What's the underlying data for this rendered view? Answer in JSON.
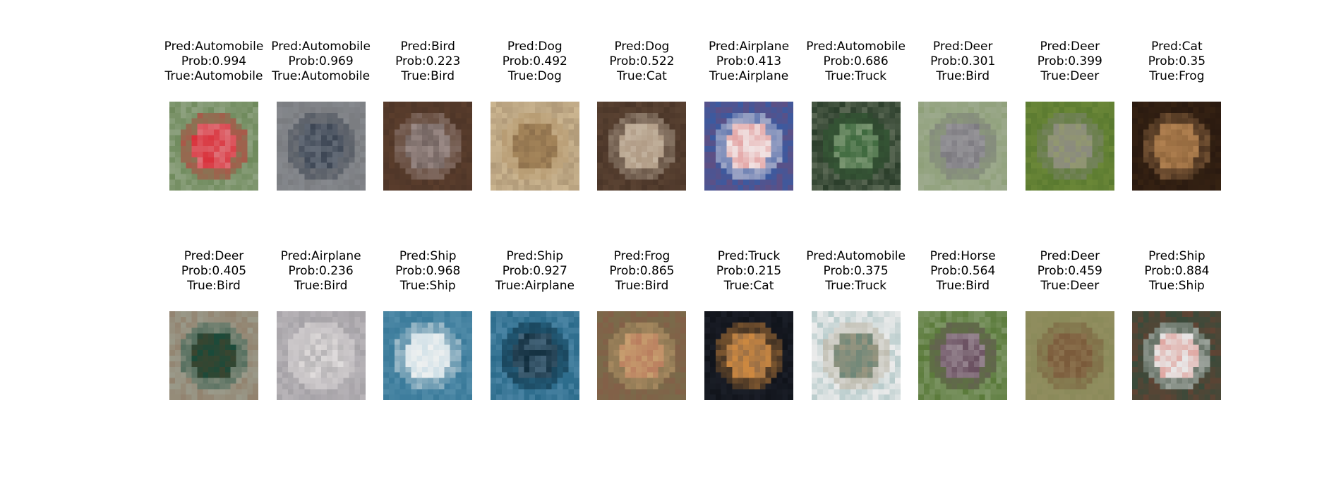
{
  "samples": [
    {
      "pred": "Pred:Automobile",
      "prob": "Prob:0.994",
      "true": "True:Automobile",
      "subject": "red-car-photo",
      "colors": {
        "bg": "#6f8a5c",
        "fg": "#d9303a",
        "accent": "#e8e8e8"
      }
    },
    {
      "pred": "Pred:Automobile",
      "prob": "Prob:0.969",
      "true": "True:Automobile",
      "subject": "gray-car-photo",
      "colors": {
        "bg": "#7a7c80",
        "fg": "#3d4654",
        "accent": "#aab0b8"
      }
    },
    {
      "pred": "Pred:Bird",
      "prob": "Prob:0.223",
      "true": "True:Bird",
      "subject": "ostrich-head-photo",
      "colors": {
        "bg": "#5a3d2c",
        "fg": "#9b8a86",
        "accent": "#2a1f1c"
      }
    },
    {
      "pred": "Pred:Dog",
      "prob": "Prob:0.492",
      "true": "True:Dog",
      "subject": "dog-paws-photo",
      "colors": {
        "bg": "#cbb590",
        "fg": "#a8885c",
        "accent": "#5e4630"
      }
    },
    {
      "pred": "Pred:Dog",
      "prob": "Prob:0.522",
      "true": "True:Cat",
      "subject": "cat-photo",
      "colors": {
        "bg": "#4a3528",
        "fg": "#c4b4a0",
        "accent": "#8a6a50"
      }
    },
    {
      "pred": "Pred:Airplane",
      "prob": "Prob:0.413",
      "true": "True:Airplane",
      "subject": "stunt-plane-photo",
      "colors": {
        "bg": "#3b5aa0",
        "fg": "#f2e6e6",
        "accent": "#c93030"
      }
    },
    {
      "pred": "Pred:Automobile",
      "prob": "Prob:0.686",
      "true": "True:Truck",
      "subject": "green-truck-photo",
      "colors": {
        "bg": "#2a3d2a",
        "fg": "#3f6a3f",
        "accent": "#e8e8d0"
      }
    },
    {
      "pred": "Pred:Deer",
      "prob": "Prob:0.301",
      "true": "True:Bird",
      "subject": "emu-photo",
      "colors": {
        "bg": "#8fa07a",
        "fg": "#7c7a80",
        "accent": "#c8c8c8"
      }
    },
    {
      "pred": "Pred:Deer",
      "prob": "Prob:0.399",
      "true": "True:Deer",
      "subject": "deer-in-grass-photo",
      "colors": {
        "bg": "#5a7a30",
        "fg": "#8a8a80",
        "accent": "#a0b050"
      }
    },
    {
      "pred": "Pred:Cat",
      "prob": "Prob:0.35",
      "true": "True:Frog",
      "subject": "frog-dark-photo",
      "colors": {
        "bg": "#2a1a10",
        "fg": "#b08050",
        "accent": "#5a3a1a"
      }
    },
    {
      "pred": "Pred:Deer",
      "prob": "Prob:0.405",
      "true": "True:Bird",
      "subject": "pheasant-photo",
      "colors": {
        "bg": "#9a9a8a",
        "fg": "#1a4a3a",
        "accent": "#7a3a1a"
      }
    },
    {
      "pred": "Pred:Airplane",
      "prob": "Prob:0.236",
      "true": "True:Bird",
      "subject": "heron-photo",
      "colors": {
        "bg": "#b8b4b8",
        "fg": "#e0dcdc",
        "accent": "#6a6a70"
      }
    },
    {
      "pred": "Pred:Ship",
      "prob": "Prob:0.968",
      "true": "True:Ship",
      "subject": "sailboat-photo",
      "colors": {
        "bg": "#3a7a9a",
        "fg": "#eef0f0",
        "accent": "#9ac4d8"
      }
    },
    {
      "pred": "Pred:Ship",
      "prob": "Prob:0.927",
      "true": "True:Airplane",
      "subject": "seaplanes-photo",
      "colors": {
        "bg": "#2a6a8a",
        "fg": "#0e2a3a",
        "accent": "#a8d0ee"
      }
    },
    {
      "pred": "Pred:Frog",
      "prob": "Prob:0.865",
      "true": "True:Bird",
      "subject": "sparrow-photo",
      "colors": {
        "bg": "#7a6a4a",
        "fg": "#c8a070",
        "accent": "#a04040"
      }
    },
    {
      "pred": "Pred:Truck",
      "prob": "Prob:0.215",
      "true": "True:Cat",
      "subject": "orange-cat-photo",
      "colors": {
        "bg": "#10131a",
        "fg": "#d08a40",
        "accent": "#3a4050"
      }
    },
    {
      "pred": "Pred:Automobile",
      "prob": "Prob:0.375",
      "true": "True:Truck",
      "subject": "toy-truck-photo",
      "colors": {
        "bg": "#ececec",
        "fg": "#9a9680",
        "accent": "#1a6a6a"
      }
    },
    {
      "pred": "Pred:Horse",
      "prob": "Prob:0.564",
      "true": "True:Bird",
      "subject": "ostrich-photo",
      "colors": {
        "bg": "#5a7a3a",
        "fg": "#6a5060",
        "accent": "#e8e8e8"
      }
    },
    {
      "pred": "Pred:Deer",
      "prob": "Prob:0.459",
      "true": "True:Deer",
      "subject": "stag-photo",
      "colors": {
        "bg": "#8a8a5a",
        "fg": "#7a5a3a",
        "accent": "#a89a70"
      }
    },
    {
      "pred": "Pred:Ship",
      "prob": "Prob:0.884",
      "true": "True:Ship",
      "subject": "motorboat-photo",
      "colors": {
        "bg": "#3a4a3a",
        "fg": "#e8e8e8",
        "accent": "#d03020"
      }
    }
  ]
}
